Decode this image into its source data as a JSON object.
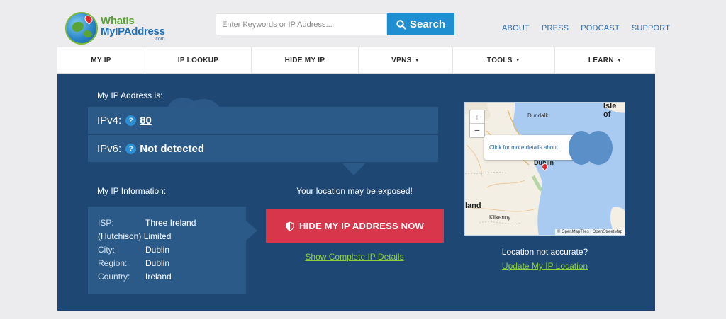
{
  "logo": {
    "line1": "WhatIs",
    "line2": "MyIPAddress",
    "suffix": ".com"
  },
  "search": {
    "placeholder": "Enter Keywords or IP Address...",
    "button_label": "Search"
  },
  "top_links": [
    "ABOUT",
    "PRESS",
    "PODCAST",
    "SUPPORT"
  ],
  "nav": [
    {
      "label": "MY IP",
      "dropdown": false
    },
    {
      "label": "IP LOOKUP",
      "dropdown": false
    },
    {
      "label": "HIDE MY IP",
      "dropdown": false
    },
    {
      "label": "VPNS",
      "dropdown": true
    },
    {
      "label": "TOOLS",
      "dropdown": true
    },
    {
      "label": "LEARN",
      "dropdown": true
    }
  ],
  "nav_caret": "▼",
  "ip": {
    "heading": "My IP Address is:",
    "ipv4_label": "IPv4:",
    "ipv4_value": "80",
    "ipv6_label": "IPv6:",
    "ipv6_value": "Not detected",
    "help_glyph": "?"
  },
  "info": {
    "heading": "My IP Information:",
    "isp_label": "ISP:",
    "isp_value": "Three Ireland",
    "isp_value_cont": "(Hutchison) Limited",
    "city_label": "City:",
    "city_value": "Dublin",
    "region_label": "Region:",
    "region_value": "Dublin",
    "country_label": "Country:",
    "country_value": "Ireland"
  },
  "cta": {
    "exposed_text": "Your location may be exposed!",
    "hide_button": "HIDE MY IP ADDRESS NOW",
    "details_link": "Show Complete IP Details"
  },
  "map": {
    "zoom_in": "+",
    "zoom_out": "−",
    "popup_text": "Click for more details about",
    "labels": {
      "dundalk": "Dundalk",
      "isle": "Isle of",
      "dublin": "Dublin",
      "ireland": "land",
      "kilkenny": "Kilkenny"
    },
    "attribution": "© OpenMapTiles | OpenStreetMap"
  },
  "location": {
    "not_accurate": "Location not accurate?",
    "update_link": "Update My IP Location"
  },
  "colors": {
    "panel": "#1e4774",
    "panel_box": "#2c5a88",
    "accent_blue": "#1f8fd1",
    "cta_red": "#d8364a",
    "link_green": "#8fcf3e"
  }
}
